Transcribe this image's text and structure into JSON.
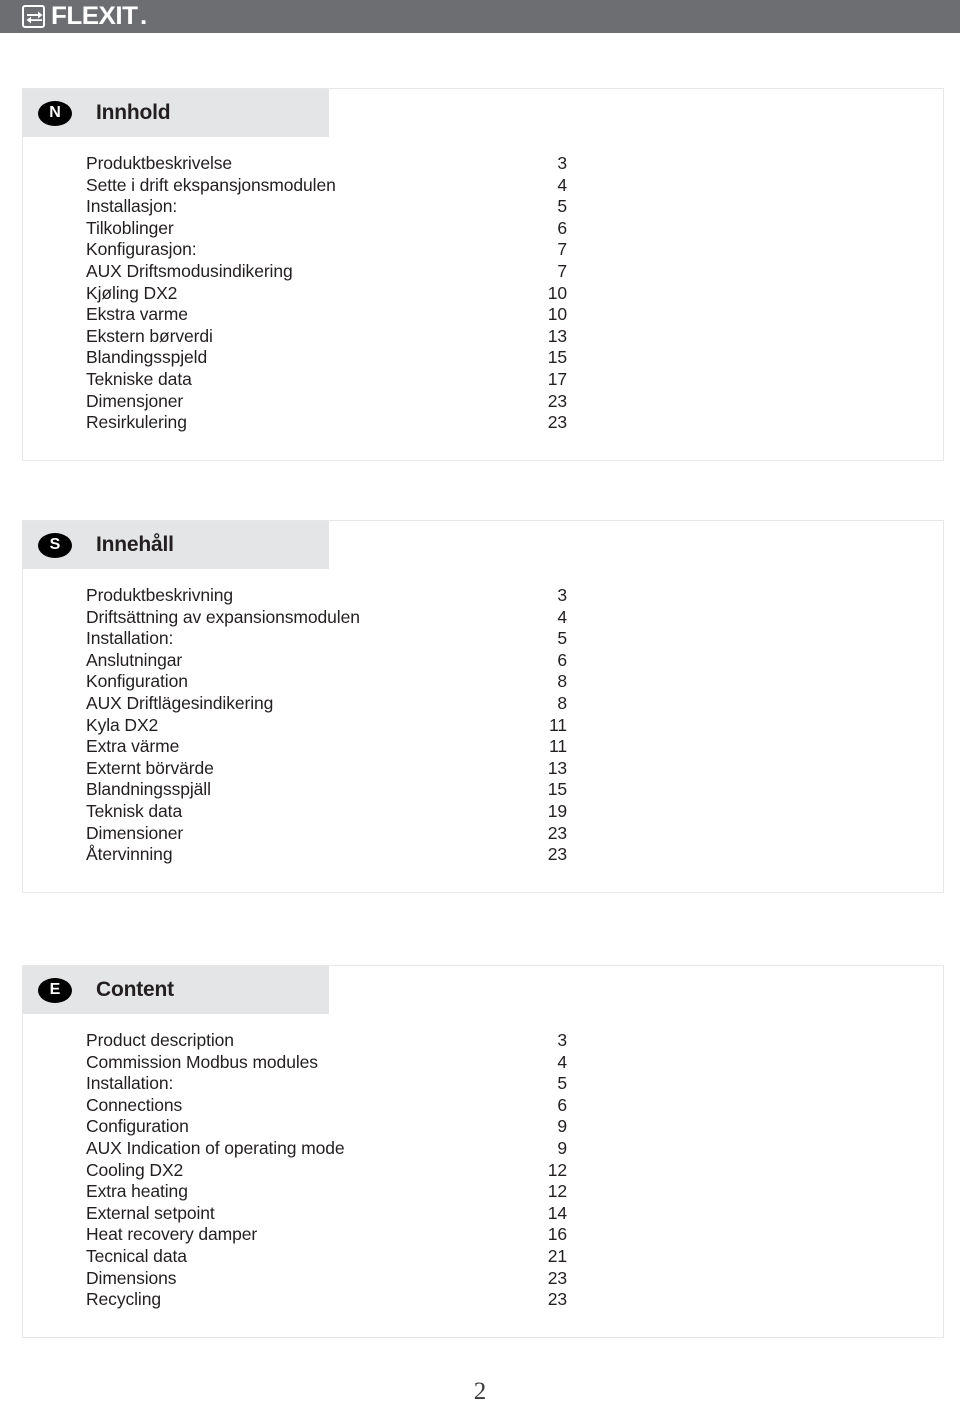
{
  "brand": {
    "logo_text": "FLEXIT",
    "logo_suffix": ".",
    "logo_icon": "flexit-arrows-icon"
  },
  "sections": [
    {
      "badge": "N",
      "language": "Norwegian",
      "title": "Innhold",
      "entries": [
        {
          "label": "Produktbeskrivelse",
          "page": "3"
        },
        {
          "label": "Sette i drift ekspansjonsmodulen",
          "page": "4"
        },
        {
          "label": "Installasjon:",
          "page": "5"
        },
        {
          "label": "Tilkoblinger",
          "page": "6"
        },
        {
          "label": "Konfigurasjon:",
          "page": "7"
        },
        {
          "label": "AUX Driftsmodusindikering",
          "page": "7"
        },
        {
          "label": "Kjøling DX2",
          "page": "10"
        },
        {
          "label": "Ekstra varme",
          "page": "10"
        },
        {
          "label": "Ekstern børverdi",
          "page": "13"
        },
        {
          "label": "Blandingsspjeld",
          "page": "15"
        },
        {
          "label": "Tekniske data",
          "page": "17"
        },
        {
          "label": "Dimensjoner",
          "page": "23"
        },
        {
          "label": "Resirkulering",
          "page": "23"
        }
      ]
    },
    {
      "badge": "S",
      "language": "Swedish",
      "title": "Innehåll",
      "entries": [
        {
          "label": "Produktbeskrivning",
          "page": "3"
        },
        {
          "label": "Driftsättning av expansionsmodulen",
          "page": "4"
        },
        {
          "label": "Installation:",
          "page": "5"
        },
        {
          "label": "Anslutningar",
          "page": "6"
        },
        {
          "label": "Konfiguration",
          "page": "8"
        },
        {
          "label": "AUX Driftlägesindikering",
          "page": "8"
        },
        {
          "label": "Kyla DX2",
          "page": "11"
        },
        {
          "label": "Extra värme",
          "page": "11"
        },
        {
          "label": "Externt börvärde",
          "page": "13"
        },
        {
          "label": "Blandningsspjäll",
          "page": "15"
        },
        {
          "label": "Teknisk data",
          "page": "19"
        },
        {
          "label": "Dimensioner",
          "page": "23"
        },
        {
          "label": "Återvinning",
          "page": "23"
        }
      ]
    },
    {
      "badge": "E",
      "language": "English",
      "title": "Content",
      "entries": [
        {
          "label": "Product description",
          "page": "3"
        },
        {
          "label": "Commission Modbus modules",
          "page": "4"
        },
        {
          "label": "Installation:",
          "page": "5"
        },
        {
          "label": "Connections",
          "page": "6"
        },
        {
          "label": "Configuration",
          "page": "9"
        },
        {
          "label": "AUX Indication of operating mode",
          "page": "9"
        },
        {
          "label": "Cooling DX2",
          "page": "12"
        },
        {
          "label": "Extra heating",
          "page": "12"
        },
        {
          "label": "External setpoint",
          "page": "14"
        },
        {
          "label": "Heat recovery damper",
          "page": "16"
        },
        {
          "label": "Tecnical data",
          "page": "21"
        },
        {
          "label": "Dimensions",
          "page": "23"
        },
        {
          "label": "Recycling",
          "page": "23"
        }
      ]
    }
  ],
  "footer": {
    "page_number": "2"
  },
  "colors": {
    "brandbar": "#6d6e71",
    "section_head": "#e4e5e6",
    "border": "#e6e7e8",
    "text": "#231f20"
  }
}
